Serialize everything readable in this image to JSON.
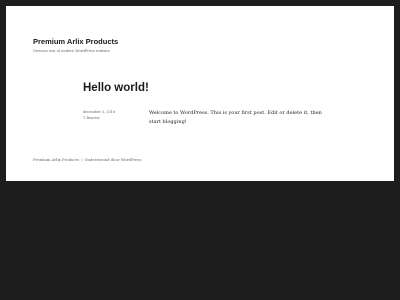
{
  "site": {
    "title": "Premium Arlix Products",
    "tagline": "Gewoon een of andere WordPress website"
  },
  "post": {
    "title": "Hello world!",
    "date": "december 3, 2016",
    "category": "1 Reactie",
    "content": "Welcome to WordPress. This is your first post. Edit or delete it, then start blogging!"
  },
  "footer": {
    "site_link": "Premium Arlix Products",
    "separator": "/",
    "powered_by": "Ondersteund door WordPress"
  },
  "colors": {
    "background": "#1d1d1d",
    "content_bg": "#ffffff",
    "text": "#1a1a1a",
    "muted": "#686868"
  }
}
